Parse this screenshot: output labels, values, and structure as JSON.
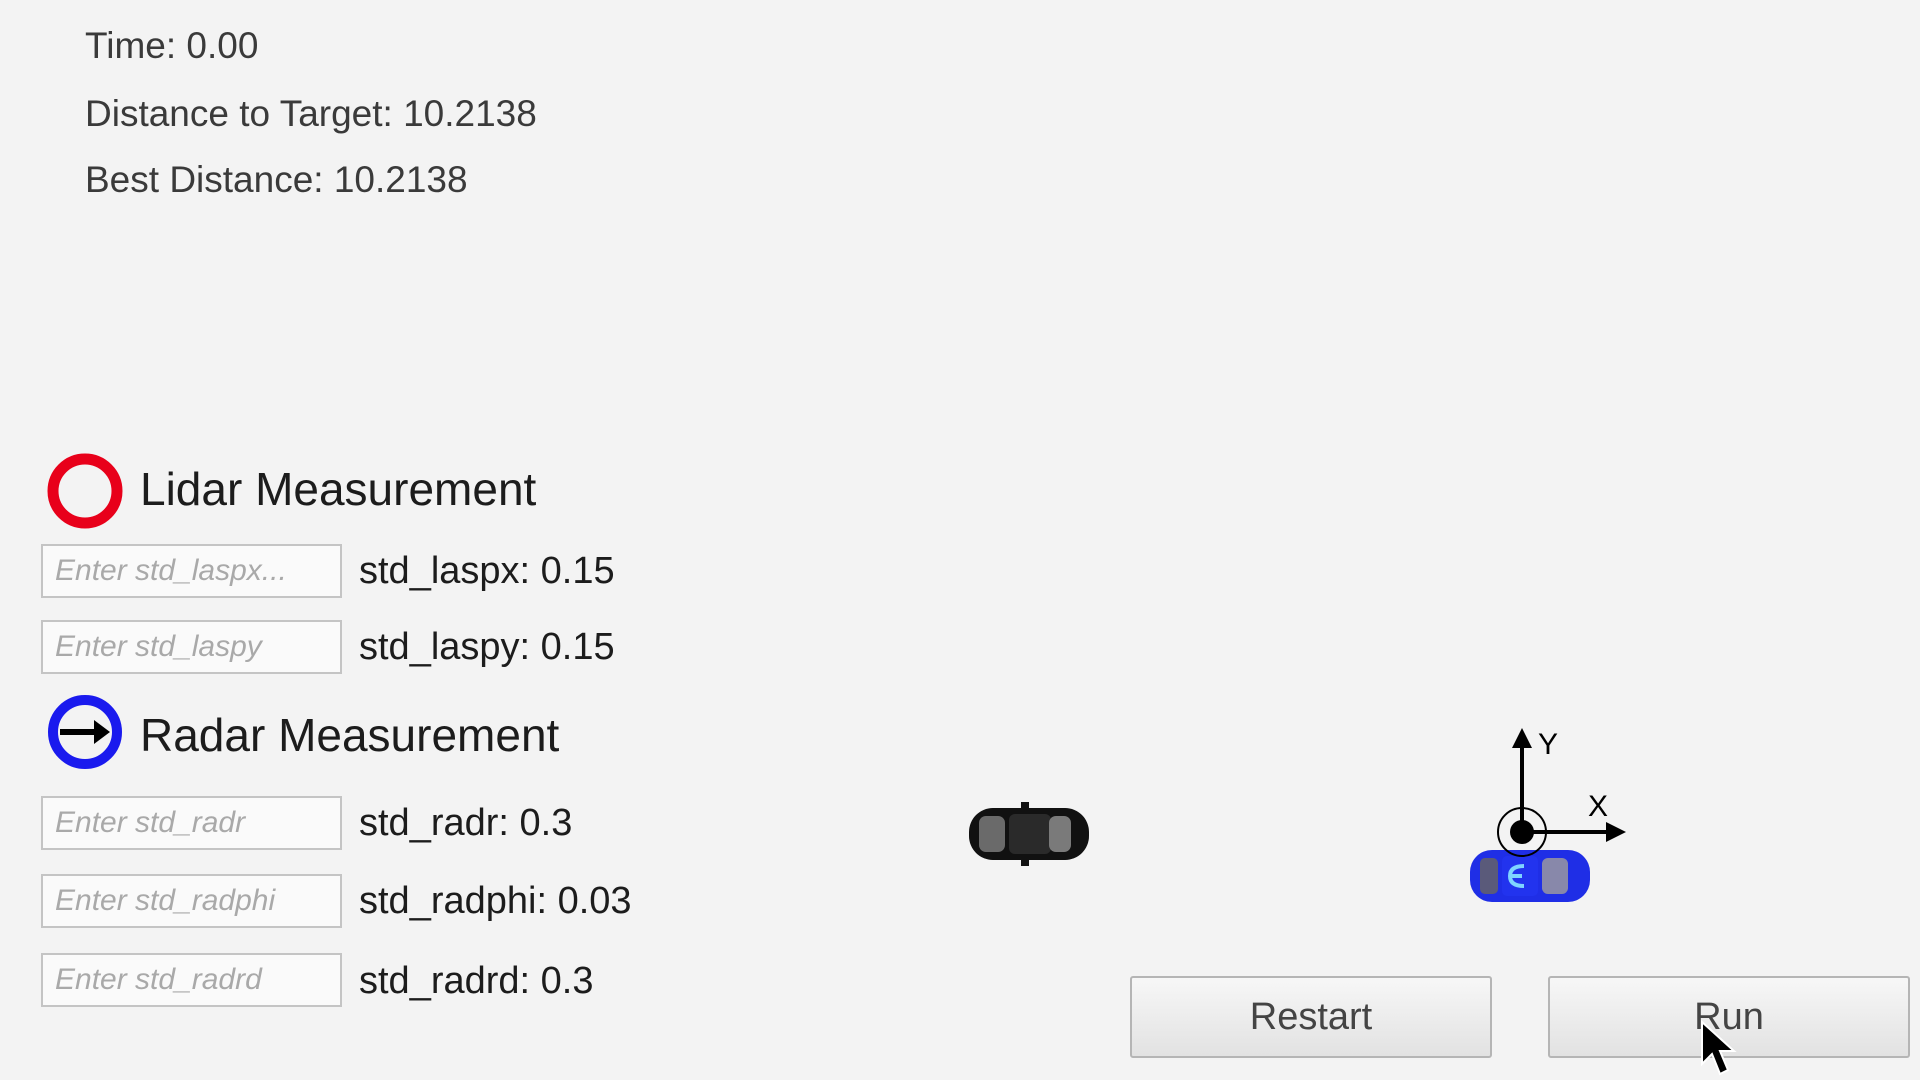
{
  "stats": {
    "time": "Time: 0.00",
    "distance_to_target": "Distance to Target: 10.2138",
    "best_distance": "Best Distance: 10.2138"
  },
  "lidar": {
    "title": "Lidar Measurement",
    "icon": "red-circle-icon",
    "icon_color": "#e8001a",
    "fields": [
      {
        "placeholder": "Enter std_laspx...",
        "label": "std_laspx: 0.15"
      },
      {
        "placeholder": "Enter std_laspy",
        "label": "std_laspy: 0.15"
      }
    ]
  },
  "radar": {
    "title": "Radar Measurement",
    "icon": "blue-circle-arrow-icon",
    "icon_color": "#1a1aee",
    "fields": [
      {
        "placeholder": "Enter std_radr",
        "label": "std_radr: 0.3"
      },
      {
        "placeholder": "Enter std_radphi",
        "label": "std_radphi: 0.03"
      },
      {
        "placeholder": "Enter std_radrd",
        "label": "std_radrd: 0.3"
      }
    ]
  },
  "axes": {
    "x_label": "X",
    "y_label": "Y"
  },
  "buttons": {
    "restart": "Restart",
    "run": "Run"
  },
  "cars": {
    "target_car_color": "#111111",
    "ego_car_color": "#1f2ee6"
  }
}
